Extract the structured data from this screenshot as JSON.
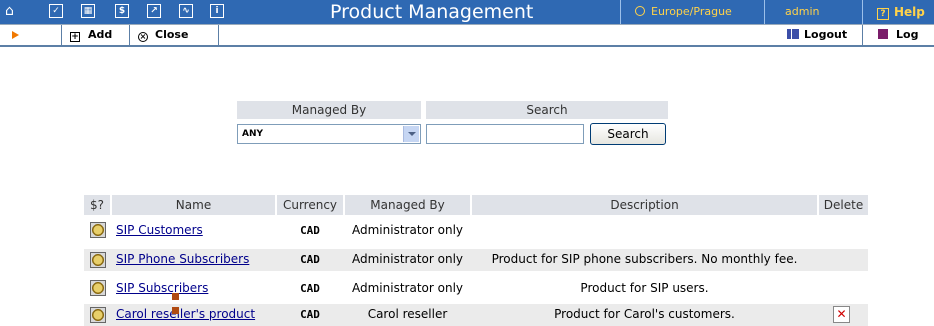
{
  "header": {
    "title": "Product Management",
    "timezone": "Europe/Prague",
    "user": "admin",
    "help": "Help"
  },
  "toolbar": {
    "add": "Add",
    "close": "Close",
    "logout": "Logout",
    "log": "Log"
  },
  "filter": {
    "managed_by_label": "Managed By",
    "managed_by_value": "ANY",
    "search_label": "Search",
    "search_value": "",
    "search_button": "Search"
  },
  "table": {
    "columns": [
      "$?",
      "Name",
      "Currency",
      "Managed By",
      "Description",
      "Delete"
    ],
    "rows": [
      {
        "name": "SIP Customers",
        "currency": "CAD",
        "managed_by": "Administrator only",
        "description": ""
      },
      {
        "name": "SIP Phone Subscribers",
        "currency": "CAD",
        "managed_by": "Administrator only",
        "description": "Product for SIP phone subscribers. No monthly fee."
      },
      {
        "name": "SIP Subscribers",
        "currency": "CAD",
        "managed_by": "Administrator only",
        "description": "Product for SIP users."
      },
      {
        "name": "Carol reseller's product",
        "currency": "CAD",
        "managed_by": "Carol reseller",
        "description": "Product for Carol's customers."
      }
    ]
  },
  "icons": [
    "home-icon",
    "checkbox-icon",
    "grid-icon",
    "dollar-icon",
    "export-icon",
    "chart-icon",
    "info-icon",
    "clock-icon",
    "help-icon",
    "arrow-icon",
    "add-icon",
    "close-icon",
    "logout-icon",
    "log-icon",
    "rate-icon",
    "delete-icon"
  ],
  "colors": {
    "header_bg": "#2f69b3",
    "header_accent": "#ffd24a",
    "link": "#00008b",
    "row_alt": "#ebebeb",
    "delete": "#d00000"
  }
}
